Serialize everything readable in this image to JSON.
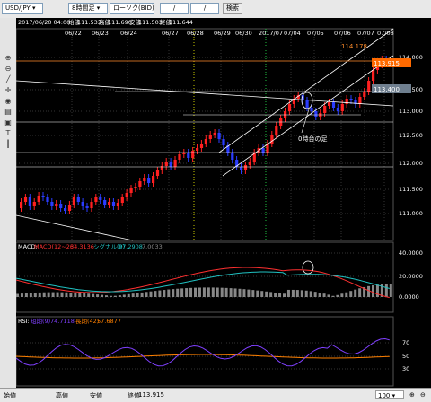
{
  "toolbar": {
    "pair": "USD/JPY",
    "timeframe": "8時間足",
    "chart_type": "ローソク(BID)",
    "date_from": "/",
    "date_to": "/",
    "search_label": "検索"
  },
  "sidebar": {
    "icons": [
      "zoom-in-icon",
      "zoom-out-icon",
      "line-tool-icon",
      "text-tool-icon",
      "trendline-icon",
      "ruler-icon",
      "eye-icon",
      "print-icon",
      "save-icon"
    ]
  },
  "ohlc_bar": {
    "date": "2017/06/20 04:00",
    "open_label": "始値",
    "open": "111.533",
    "high_label": "高値",
    "high": "111.690",
    "low_label": "安値",
    "low": "111.503",
    "close_label": "終値",
    "close": "111.644"
  },
  "main_chart": {
    "date_labels": [
      "06/22",
      "06/23",
      "06/24",
      "06/27",
      "06/28",
      "06/29",
      "06/30",
      "2017/07",
      "07/04",
      "07/05",
      "07/06",
      "07/07",
      "07/08"
    ],
    "price_labels": [
      "114.000",
      "113.500",
      "113.000",
      "112.500",
      "112.000",
      "111.500",
      "111.000"
    ],
    "price_tags": {
      "current": "113.915",
      "level": "113.400"
    },
    "annotation_price": "114.178",
    "annotation_text": "0時台の足"
  },
  "macd": {
    "label": "MACD:",
    "macd_label": "MACD(12~26)",
    "macd_value": "34.3136",
    "signal_label": "シグナル(9)",
    "signal_value": "27.2908",
    "histogram_value": "7.0033",
    "axis": [
      "40.0000",
      "20.0000",
      "0.0000"
    ]
  },
  "rsi": {
    "label": "RSI:",
    "short_label": "短期(9)",
    "short_value": "74.7118",
    "long_label": "長期(42)",
    "long_value": "57.6877",
    "axis": [
      "70",
      "50",
      "30"
    ]
  },
  "status": {
    "open_label": "始値",
    "high_label": "高値",
    "low_label": "安値",
    "close_label": "終値",
    "close_value": "113.915",
    "count": "100"
  },
  "colors": {
    "bull": "#ff2020",
    "bear": "#2a3cff",
    "current_tag": "#ff6a00",
    "level_tag": "#6f7f8f",
    "macd": "#ff3030",
    "signal": "#20c0c0",
    "rsi_short": "#8040ff",
    "rsi_long": "#ff8000"
  }
}
